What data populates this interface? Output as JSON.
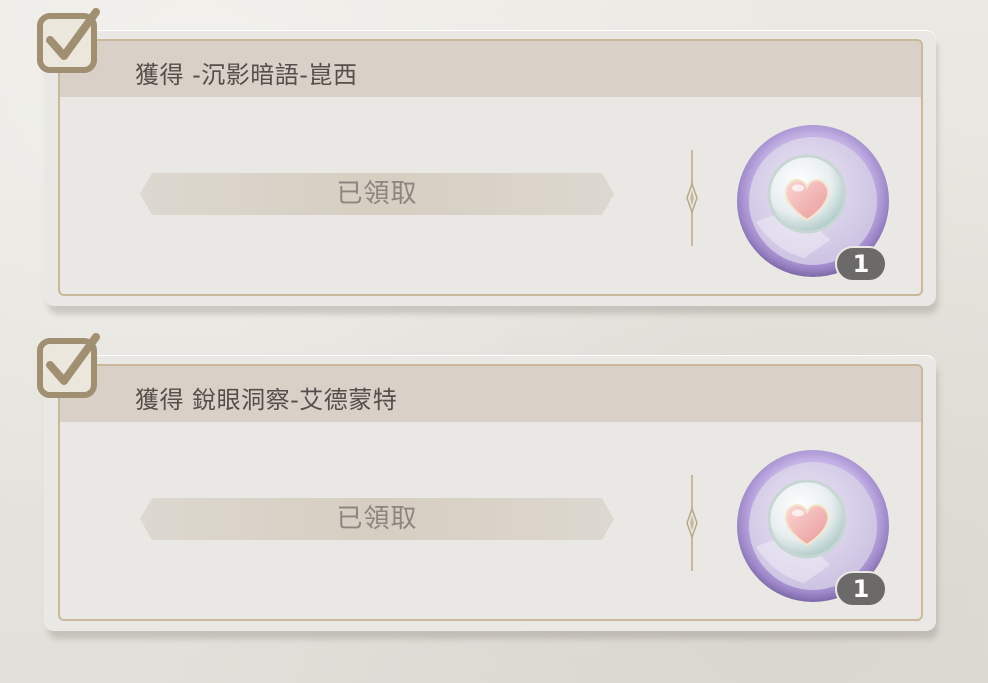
{
  "quests": [
    {
      "title": "獲得 -沉影暗語-崑西",
      "status_label": "已領取",
      "completed": true,
      "reward": {
        "icon": "heart-orb-icon",
        "quantity": "1"
      }
    },
    {
      "title": "獲得 銳眼洞察-艾德蒙特",
      "status_label": "已領取",
      "completed": true,
      "reward": {
        "icon": "heart-orb-icon",
        "quantity": "1"
      }
    }
  ],
  "colors": {
    "card_background": "#e9e8e4",
    "card_header": "#d9d0c8",
    "frame_gold": "#c9b99a",
    "checkbox_brown": "#a08f71",
    "reward_ring_purple": "#a78fd0",
    "quantity_badge": "#6c6a68"
  }
}
